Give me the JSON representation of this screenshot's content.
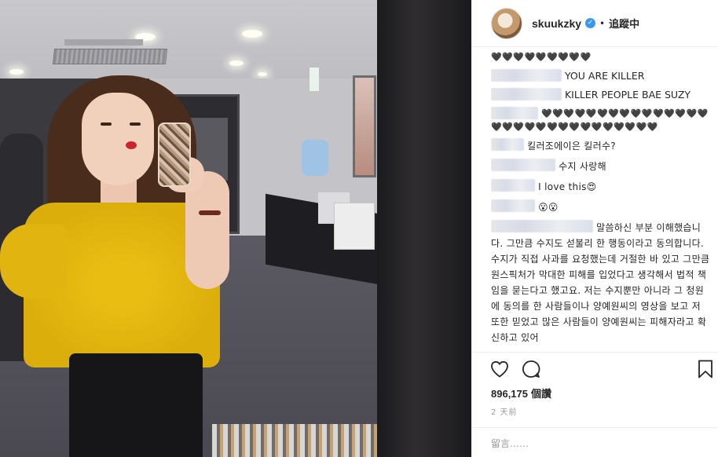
{
  "post": {
    "username": "skuukzky",
    "follow_status": "追蹤中",
    "separator": "•",
    "verified_mark": "✓"
  },
  "comments": [
    {
      "text": "🖤🖤🖤🖤🖤🖤🖤🖤🖤",
      "redacted": false
    },
    {
      "text": "YOU ARE KILLER",
      "redacted": true
    },
    {
      "text": "KILLER PEOPLE BAE SUZY",
      "redacted": true
    },
    {
      "text": "🖤🖤🖤🖤🖤🖤🖤🖤🖤🖤🖤🖤🖤🖤🖤🖤🖤🖤🖤🖤🖤🖤🖤🖤🖤🖤🖤🖤🖤🖤",
      "redacted": true
    },
    {
      "text": "킬러조에이은 킬러수?",
      "redacted": true
    },
    {
      "text": "수지 사랑해",
      "redacted": true
    },
    {
      "text": "I love this😍",
      "redacted": true
    },
    {
      "text": "😮😮",
      "redacted": true
    },
    {
      "text": "말씀하신 부분 이해했습니다. 그만큼 수지도 섣불리 한 행동이라고 동의합니다. 수지가 직접 사과를 요청했는데 거절한 바 있고 그만큼 원스픽처가 막대한 피해를 입었다고 생각해서 법적 책임을 묻는다고 했고요. 저는 수지뿐만 아니라 그 청원에 동의를 한 사람들이나 양예원씨의 영상을 보고 저 또한 믿었고 많은 사람들이 양예원씨는 피해자라고 확신하고 있어",
      "redacted": true
    }
  ],
  "actions": {
    "like_icon": "heart-icon",
    "comment_icon": "comment-icon",
    "save_icon": "bookmark-icon",
    "likes_count": "896,175",
    "likes_unit": "個讚",
    "timestamp": "2 天前",
    "comment_placeholder": "留言……"
  }
}
